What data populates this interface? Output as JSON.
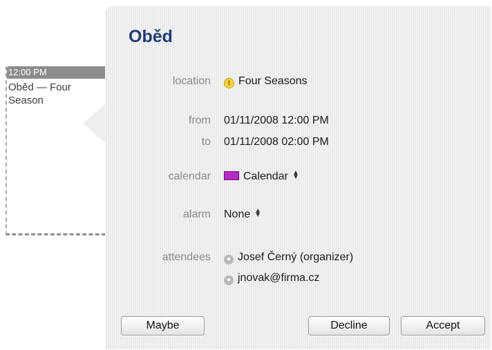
{
  "event_tile": {
    "time": "12:00 PM",
    "text": "Oběd — Four\nSeason"
  },
  "popover": {
    "title": "Oběd",
    "location": {
      "label": "location",
      "value": "Four Seasons",
      "icon": "warning-icon"
    },
    "from": {
      "label": "from",
      "value": "01/11/2008 12:00 PM"
    },
    "to": {
      "label": "to",
      "value": "01/11/2008 02:00 PM"
    },
    "calendar": {
      "label": "calendar",
      "value": "Calendar",
      "color": "#b52bc5"
    },
    "alarm": {
      "label": "alarm",
      "value": "None"
    },
    "attendees": {
      "label": "attendees",
      "items": [
        "Josef Černý (organizer)",
        "jnovak@firma.cz"
      ]
    },
    "buttons": {
      "maybe": "Maybe",
      "decline": "Decline",
      "accept": "Accept"
    }
  }
}
